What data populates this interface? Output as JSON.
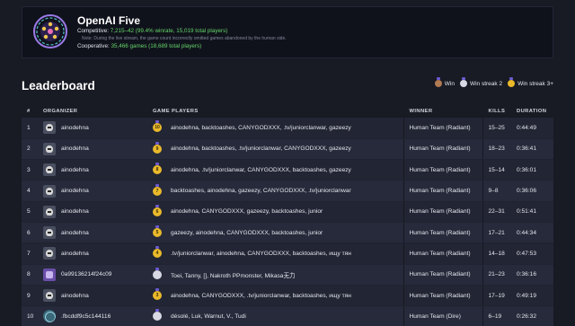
{
  "summary": {
    "title": "OpenAI Five",
    "competitive_label": "Competitive:",
    "competitive_value": "7,215–42 (99.4% winrate, 15,019 total players)",
    "note": "Note: During the live stream, the game count incorrectly omitted games abandoned by the human side.",
    "cooperative_label": "Cooperative:",
    "cooperative_value": "35,466 games (18,689 total players)"
  },
  "leaderboard": {
    "heading": "Leaderboard",
    "legend": [
      {
        "label": "Win",
        "icon": "bronze-medal-icon",
        "color": "#b07a52"
      },
      {
        "label": "Win streak 2",
        "icon": "silver-medal-icon",
        "color": "#d9d9e6"
      },
      {
        "label": "Win streak 3+",
        "icon": "gold-medal-icon",
        "color": "#e9b92b"
      }
    ],
    "columns": [
      "#",
      "ORGANIZER",
      "GAME PLAYERS",
      "WINNER",
      "KILLS",
      "DURATION"
    ],
    "rows": [
      {
        "rank": "1",
        "organizer": "ainodehna",
        "streak": "10",
        "players": "ainodehna, backtoashes, CANYGODXXX, .tv/juniorclanwar, gazeezy",
        "winner": "Human Team (Radiant)",
        "kills": "15–25",
        "duration": "0:44:49"
      },
      {
        "rank": "2",
        "organizer": "ainodehna",
        "streak": "9",
        "players": "ainodehna, backtoashes, .tv/juniorclanwar, CANYGODXXX, gazeezy",
        "winner": "Human Team (Radiant)",
        "kills": "18–23",
        "duration": "0:36:41"
      },
      {
        "rank": "3",
        "organizer": "ainodehna",
        "streak": "8",
        "players": "ainodehna, .tv/juniorclanwar, CANYGODXXX, backtoashes, gazeezy",
        "winner": "Human Team (Radiant)",
        "kills": "15–14",
        "duration": "0:36:01"
      },
      {
        "rank": "4",
        "organizer": "ainodehna",
        "streak": "7",
        "players": "backtoashes, ainodehna, gazeezy, CANYGODXXX, .tv/juniorclanwar",
        "winner": "Human Team (Radiant)",
        "kills": "9–8",
        "duration": "0:36:06"
      },
      {
        "rank": "5",
        "organizer": "ainodehna",
        "streak": "6",
        "players": "ainodehna, CANYGODXXX, gazeezy, backtoashes, junior",
        "winner": "Human Team (Radiant)",
        "kills": "22–31",
        "duration": "0:51:41"
      },
      {
        "rank": "6",
        "organizer": "ainodehna",
        "streak": "5",
        "players": "gazeezy, ainodehna, CANYGODXXX, backtoashes, junior",
        "winner": "Human Team (Radiant)",
        "kills": "17–21",
        "duration": "0:44:34"
      },
      {
        "rank": "7",
        "organizer": "ainodehna",
        "streak": "4",
        "players": ".tv/juniorclanwar, ainodehna, CANYGODXXX, backtoashes, ищу тян",
        "winner": "Human Team (Radiant)",
        "kills": "14–18",
        "duration": "0:47:53"
      },
      {
        "rank": "8",
        "organizer": "0a99136214f24c09",
        "streak": "",
        "players": "Toei, Tanny, [], Nakroth PPmonster, Mikasa无力",
        "winner": "Human Team (Radiant)",
        "kills": "21–23",
        "duration": "0:36:16"
      },
      {
        "rank": "9",
        "organizer": "ainodehna",
        "streak": "3",
        "players": "ainodehna, CANYGODXXX, .tv/juniorclanwar, backtoashes, ищу тян",
        "winner": "Human Team (Radiant)",
        "kills": "17–19",
        "duration": "0:49:19"
      },
      {
        "rank": "10",
        "organizer": ".fbcddf9c5c144116",
        "streak": "",
        "players": "désolé, Luk, Warnut, V., Tudi",
        "winner": "Human Team (Dire)",
        "kills": "6–19",
        "duration": "0:26:32"
      }
    ]
  }
}
